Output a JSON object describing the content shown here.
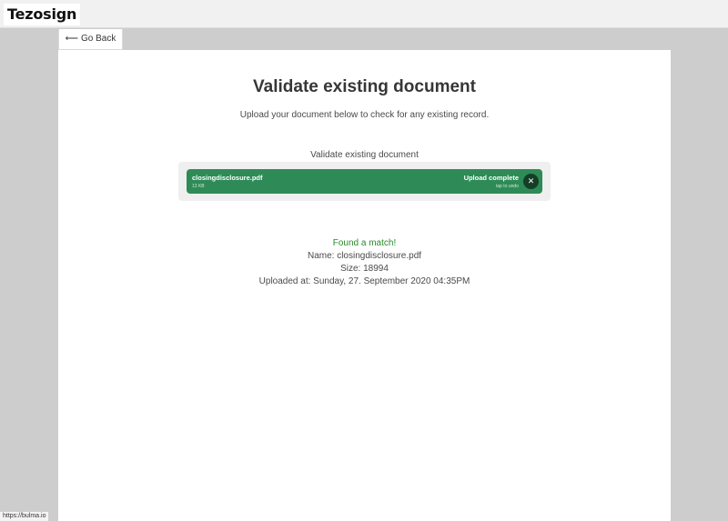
{
  "navbar": {
    "brand": "Tezosign"
  },
  "back_button": {
    "arrow": "⟵",
    "label": "Go Back"
  },
  "page": {
    "title": "Validate existing document",
    "subtitle": "Upload your document below to check for any existing record."
  },
  "upload": {
    "label": "Validate existing document",
    "file_name": "closingdisclosure.pdf",
    "file_size": "13 KB",
    "status": "Upload complete",
    "hint": "tap to undo",
    "remove_icon": "✕"
  },
  "result": {
    "match": "Found a match!",
    "name": "Name: closingdisclosure.pdf",
    "size": "Size: 18994",
    "uploaded_at": "Uploaded at: Sunday, 27. September 2020 04:35PM"
  },
  "status_bar": {
    "url": "https://bulma.io"
  },
  "colors": {
    "file_item_bg": "#2e8b57",
    "match_text": "#2a8a2a",
    "page_bg": "#cdcdcd"
  }
}
